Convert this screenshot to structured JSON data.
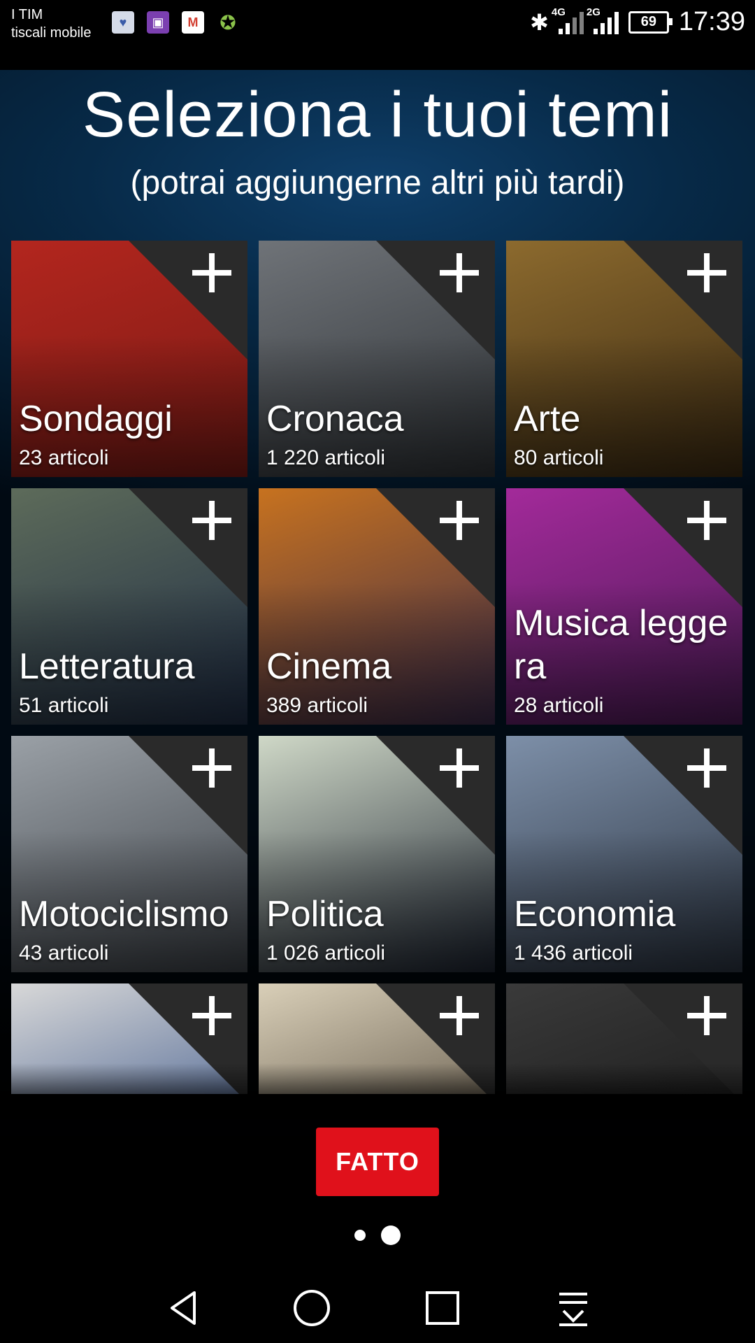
{
  "status_bar": {
    "carrier_line1": "I TIM",
    "carrier_line2": "tiscali mobile",
    "notification_icons": [
      "messenger-icon",
      "gallery-icon",
      "gmail-icon",
      "android-icon"
    ],
    "network1": "4G",
    "network2": "2G",
    "battery": "69",
    "time": "17:39"
  },
  "header": {
    "title": "Seleziona i tuoi temi",
    "subtitle": "(potrai aggiungerne altri più tardi)"
  },
  "topics": [
    {
      "name": "Sondaggi",
      "count": "23 articoli",
      "colors": [
        "#b3261e",
        "#7a1a15"
      ]
    },
    {
      "name": "Cronaca",
      "count": "1 220 articoli",
      "colors": [
        "#6f7378",
        "#2e3236"
      ]
    },
    {
      "name": "Arte",
      "count": "80 articoli",
      "colors": [
        "#8c6a2e",
        "#3b2a12"
      ]
    },
    {
      "name": "Letteratura",
      "count": "51 articoli",
      "colors": [
        "#5d6b5a",
        "#1f2d45"
      ]
    },
    {
      "name": "Cinema",
      "count": "389 articoli",
      "colors": [
        "#c7721f",
        "#3a2a4a"
      ]
    },
    {
      "name": "Musica leggera",
      "count": "28 articoli",
      "colors": [
        "#a32a9a",
        "#4a1a55"
      ]
    },
    {
      "name": "Motociclismo",
      "count": "43 articoli",
      "colors": [
        "#9aa0a6",
        "#3b4046"
      ]
    },
    {
      "name": "Politica",
      "count": "1 026 articoli",
      "colors": [
        "#cfd8c7",
        "#1c2330"
      ]
    },
    {
      "name": "Economia",
      "count": "1 436 articoli",
      "colors": [
        "#7d8fa8",
        "#2a3340"
      ]
    },
    {
      "name": "",
      "count": "",
      "colors": [
        "#d8d8d8",
        "#1b3c7a"
      ]
    },
    {
      "name": "",
      "count": "",
      "colors": [
        "#d9cfb8",
        "#3c3226"
      ]
    },
    {
      "name": "",
      "count": "",
      "colors": [
        "#3a3a3a",
        "#111111"
      ]
    }
  ],
  "actions": {
    "done_label": "FATTO"
  },
  "pager": {
    "pages": 2,
    "current": 2
  },
  "nav_icons": [
    "back-icon",
    "home-icon",
    "recents-icon",
    "notification-pull-icon"
  ],
  "colors": {
    "accent": "#e0111b"
  }
}
